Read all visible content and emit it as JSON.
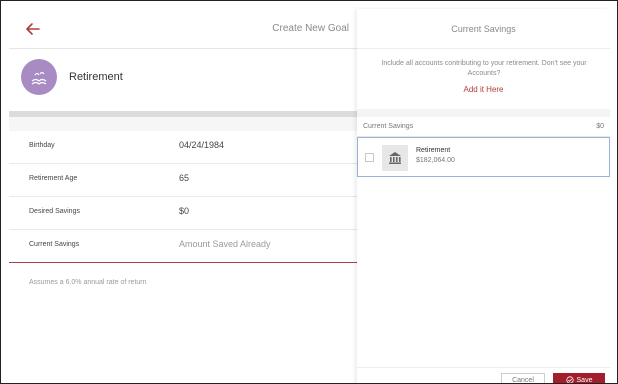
{
  "header": {
    "title": "Create New Goal"
  },
  "goal": {
    "name": "Retirement",
    "icon": "island-icon"
  },
  "fields": {
    "birthday": {
      "label": "Birthday",
      "value": "04/24/1984"
    },
    "retirement_age": {
      "label": "Retirement Age",
      "value": "65"
    },
    "desired_savings": {
      "label": "Desired Savings",
      "value": "$0"
    },
    "current_savings": {
      "label": "Current Savings",
      "placeholder": "Amount Saved Already"
    }
  },
  "assumption": "Assumes a 6.0% annual rate of return",
  "panel": {
    "title": "Current Savings",
    "info": "Include all accounts contributing to your retirement. Don't see your Accounts?",
    "link": "Add it Here",
    "list_label": "Current Savings",
    "list_total": "$0",
    "accounts": [
      {
        "name": "Retirement",
        "amount": "$182,064.00",
        "icon": "bank-icon"
      }
    ],
    "cancel_label": "Cancel",
    "save_label": "Save"
  },
  "colors": {
    "accent": "#a11f2b",
    "link": "#b23b3b",
    "avatar": "#a78bc2"
  }
}
